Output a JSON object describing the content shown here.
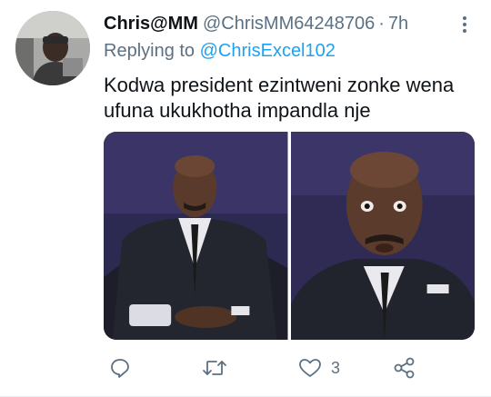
{
  "tweet": {
    "display_name": "Chris@MM",
    "handle": "@ChrisMM64248706",
    "separator": "·",
    "time": "7h",
    "replying_prefix": "Replying to ",
    "replying_to": "@ChrisExcel102",
    "text": "Kodwa president ezintweni zonke wena ufuna ukukhotha impandla nje",
    "like_count": "3"
  },
  "icons": {
    "more": "more-vertical-icon",
    "reply": "reply-icon",
    "retweet": "retweet-icon",
    "like": "heart-icon",
    "share": "share-icon"
  },
  "colors": {
    "link": "#1da1f2",
    "secondary_text": "#5b7083",
    "primary_text": "#0f1419"
  }
}
